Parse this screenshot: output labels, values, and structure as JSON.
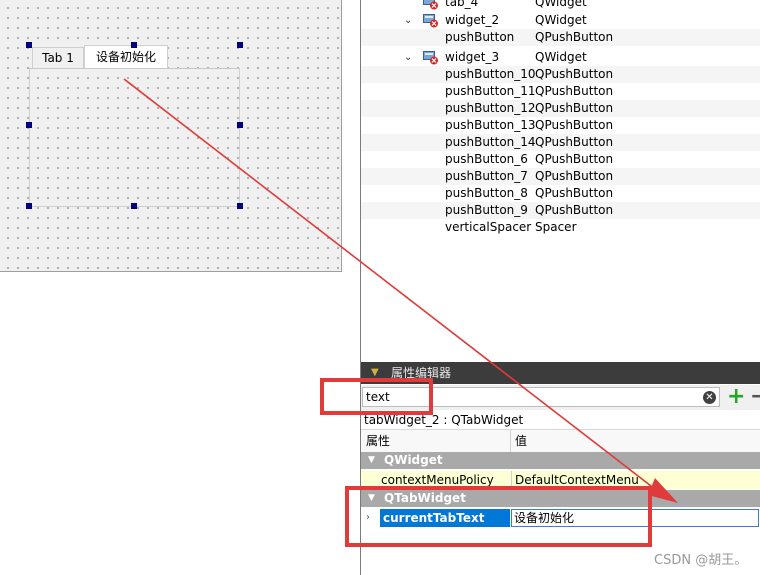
{
  "design_form": {
    "tabs": [
      "Tab 1",
      "设备初始化"
    ]
  },
  "object_tree": {
    "rows": [
      {
        "name": "tab_4",
        "cls": "QWidget",
        "expandable": false,
        "icon": "widget-icon"
      },
      {
        "name": "widget_2",
        "cls": "QWidget",
        "expandable": true,
        "icon": "widget-icon"
      },
      {
        "name": "pushButton",
        "cls": "QPushButton",
        "expandable": false,
        "icon": ""
      },
      {
        "name": "widget_3",
        "cls": "QWidget",
        "expandable": true,
        "icon": "widget-icon"
      },
      {
        "name": "pushButton_10",
        "cls": "QPushButton",
        "expandable": false,
        "icon": ""
      },
      {
        "name": "pushButton_11",
        "cls": "QPushButton",
        "expandable": false,
        "icon": ""
      },
      {
        "name": "pushButton_12",
        "cls": "QPushButton",
        "expandable": false,
        "icon": ""
      },
      {
        "name": "pushButton_13",
        "cls": "QPushButton",
        "expandable": false,
        "icon": ""
      },
      {
        "name": "pushButton_14",
        "cls": "QPushButton",
        "expandable": false,
        "icon": ""
      },
      {
        "name": "pushButton_6",
        "cls": "QPushButton",
        "expandable": false,
        "icon": ""
      },
      {
        "name": "pushButton_7",
        "cls": "QPushButton",
        "expandable": false,
        "icon": ""
      },
      {
        "name": "pushButton_8",
        "cls": "QPushButton",
        "expandable": false,
        "icon": ""
      },
      {
        "name": "pushButton_9",
        "cls": "QPushButton",
        "expandable": false,
        "icon": ""
      },
      {
        "name": "verticalSpacer",
        "cls": "Spacer",
        "expandable": false,
        "icon": ""
      }
    ]
  },
  "property_editor": {
    "title": "属性编辑器",
    "filter_value": "text",
    "object_label": "tabWidget_2 : QTabWidget",
    "col_property": "属性",
    "col_value": "值",
    "groups": [
      {
        "name": "QWidget",
        "props": [
          {
            "name": "contextMenuPolicy",
            "value": "DefaultContextMenu"
          }
        ]
      },
      {
        "name": "QTabWidget",
        "props": [
          {
            "name": "currentTabText",
            "value": "设备初始化"
          }
        ]
      }
    ]
  },
  "annotation_color": "#e03a3a",
  "watermark": "CSDN @胡王。"
}
